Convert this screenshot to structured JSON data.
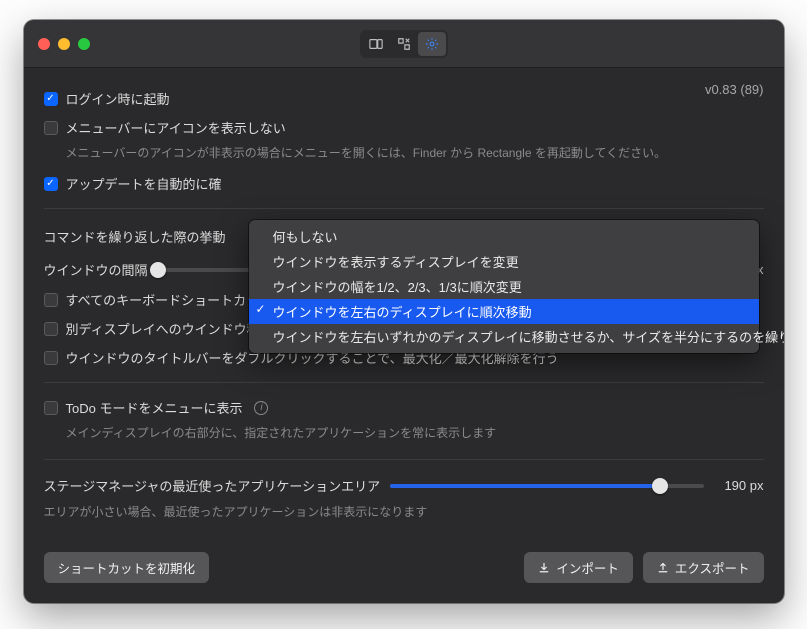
{
  "version": "v0.83 (89)",
  "launch_at_login": "ログイン時に起動",
  "hide_menubar_icon": "メニューバーにアイコンを表示しない",
  "hide_menubar_note": "メニューバーのアイコンが非表示の場合にメニューを開くには、Finder から Rectangle を再起動してください。",
  "check_updates": "アップデートを自動的に確",
  "repeat_behavior_label": "コマンドを繰り返した際の挙動",
  "window_gap_label": "ウインドウの間隔",
  "window_gap_value": "0 px",
  "allow_all_shortcuts": "すべてのキーボードショートカットを許可",
  "move_cursor_with_window": "別ディスプレイへのウインドウ移動時にカーソルも一緒に移動させる",
  "dblclick_titlebar": "ウインドウのタイトルバーをダブルクリックすることで、最大化／最大化解除を行う",
  "todo_mode": "ToDo モードをメニューに表示",
  "todo_mode_note": "メインディスプレイの右部分に、指定されたアプリケーションを常に表示します",
  "stage_manager_label": "ステージマネージャの最近使ったアプリケーションエリア",
  "stage_manager_value": "190 px",
  "stage_manager_note": "エリアが小さい場合、最近使ったアプリケーションは非表示になります",
  "reset_shortcuts": "ショートカットを初期化",
  "import": "インポート",
  "export": "エクスポート",
  "popup": {
    "opt0": "何もしない",
    "opt1": "ウインドウを表示するディスプレイを変更",
    "opt2": "ウインドウの幅を1/2、2/3、1/3に順次変更",
    "opt3": "ウインドウを左右のディスプレイに順次移動",
    "opt4": "ウインドウを左右いずれかのディスプレイに移動させるか、サイズを半分にするのを繰り返す"
  }
}
